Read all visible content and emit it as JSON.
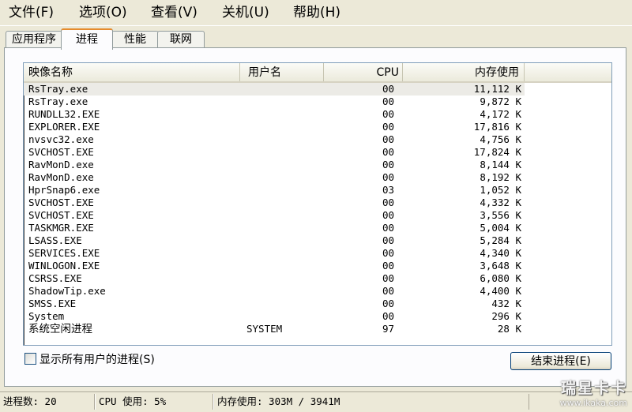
{
  "menu": [
    "文件(F)",
    "选项(O)",
    "查看(V)",
    "关机(U)",
    "帮助(H)"
  ],
  "tabs": [
    "应用程序",
    "进程",
    "性能",
    "联网"
  ],
  "columns": {
    "name": "映像名称",
    "user": "用户名",
    "cpu": "CPU",
    "mem": "内存使用"
  },
  "processes": [
    {
      "name": "RsTray.exe",
      "user": "",
      "cpu": "00",
      "mem": "11,112 K"
    },
    {
      "name": "RsTray.exe",
      "user": "",
      "cpu": "00",
      "mem": "9,872 K"
    },
    {
      "name": "RUNDLL32.EXE",
      "user": "",
      "cpu": "00",
      "mem": "4,172 K"
    },
    {
      "name": "EXPLORER.EXE",
      "user": "",
      "cpu": "00",
      "mem": "17,816 K"
    },
    {
      "name": "nvsvc32.exe",
      "user": "",
      "cpu": "00",
      "mem": "4,756 K"
    },
    {
      "name": "SVCHOST.EXE",
      "user": "",
      "cpu": "00",
      "mem": "17,824 K"
    },
    {
      "name": "RavMonD.exe",
      "user": "",
      "cpu": "00",
      "mem": "8,144 K"
    },
    {
      "name": "RavMonD.exe",
      "user": "",
      "cpu": "00",
      "mem": "8,192 K"
    },
    {
      "name": "HprSnap6.exe",
      "user": "",
      "cpu": "03",
      "mem": "1,052 K"
    },
    {
      "name": "SVCHOST.EXE",
      "user": "",
      "cpu": "00",
      "mem": "4,332 K"
    },
    {
      "name": "SVCHOST.EXE",
      "user": "",
      "cpu": "00",
      "mem": "3,556 K"
    },
    {
      "name": "TASKMGR.EXE",
      "user": "",
      "cpu": "00",
      "mem": "5,004 K"
    },
    {
      "name": "LSASS.EXE",
      "user": "",
      "cpu": "00",
      "mem": "5,284 K"
    },
    {
      "name": "SERVICES.EXE",
      "user": "",
      "cpu": "00",
      "mem": "4,340 K"
    },
    {
      "name": "WINLOGON.EXE",
      "user": "",
      "cpu": "00",
      "mem": "3,648 K"
    },
    {
      "name": "CSRSS.EXE",
      "user": "",
      "cpu": "00",
      "mem": "6,080 K"
    },
    {
      "name": "ShadowTip.exe",
      "user": "",
      "cpu": "00",
      "mem": "4,400 K"
    },
    {
      "name": "SMSS.EXE",
      "user": "",
      "cpu": "00",
      "mem": "432 K"
    },
    {
      "name": "System",
      "user": "",
      "cpu": "00",
      "mem": "296 K"
    },
    {
      "name": "系统空闲进程",
      "user": "SYSTEM",
      "cpu": "97",
      "mem": "28 K"
    }
  ],
  "show_all_users": {
    "label": "显示所有用户的进程(S)",
    "checked": false
  },
  "end_process_button": "结束进程(E)",
  "status": {
    "processes": "进程数: 20",
    "cpu": "CPU 使用: 5%",
    "memory": "内存使用: 303M / 3941M"
  },
  "watermark": {
    "brand": "瑞星卡卡",
    "url": "www.ikaka.com"
  }
}
